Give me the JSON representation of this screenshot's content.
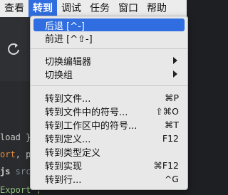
{
  "menubar": {
    "items": [
      "查看",
      "转到",
      "调试",
      "任务",
      "窗口",
      "帮助"
    ],
    "active_index": 1
  },
  "editor": {
    "lines": [
      {
        "parts": [
          "load }, "
        ]
      },
      {
        "parts": [
          "ort",
          ", pay"
        ]
      },
      {
        "parts": [
          "js",
          " src/r"
        ]
      },
      {
        "parts": [
          "Export',"
        ]
      }
    ]
  },
  "goto_menu": {
    "items": [
      {
        "label": "后退 [^-]",
        "shortcut": "",
        "selected": true
      },
      {
        "label": "前进 [^⇧-]",
        "shortcut": ""
      },
      {
        "label": "切换编辑器",
        "submenu": true
      },
      {
        "label": "切换组",
        "submenu": true
      },
      {
        "label": "转到文件...",
        "shortcut": "⌘P"
      },
      {
        "label": "转到文件中的符号...",
        "shortcut": "⇧⌘O"
      },
      {
        "label": "转到工作区中的符号...",
        "shortcut": "⌘T"
      },
      {
        "label": "转到定义...",
        "shortcut": "F12"
      },
      {
        "label": "转到类型定义",
        "shortcut": ""
      },
      {
        "label": "转到实现",
        "shortcut": "⌘F12"
      },
      {
        "label": "转到行...",
        "shortcut": "^G"
      }
    ]
  },
  "colors": {
    "menu_highlight": "#2f6de0",
    "menu_background": "#e8e8e8",
    "editor_background": "#2a2b2e"
  }
}
